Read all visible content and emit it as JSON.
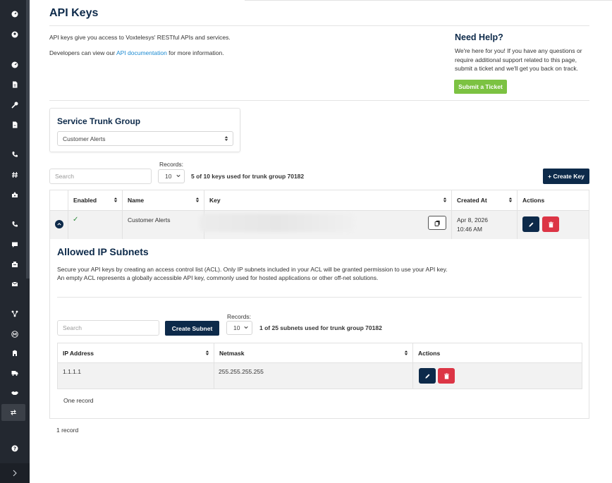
{
  "page": {
    "title": "API Keys",
    "intro_line1": "API keys give you access to Voxtelesys' RESTful APIs and services.",
    "intro_line2_prefix": "Developers can view our ",
    "intro_line2_link": "API documentation",
    "intro_line2_suffix": " for more information."
  },
  "help": {
    "title": "Need Help?",
    "line1": "We're here for you! If you have any questions or",
    "line2": "require additional support related to this page,",
    "line3": "submit a ticket and we'll get you back on track.",
    "button": "Submit a Ticket"
  },
  "trunk_group": {
    "title": "Service Trunk Group",
    "selected": "Customer Alerts"
  },
  "keys_toolbar": {
    "search_placeholder": "Search",
    "records_label": "Records:",
    "records_value": "10",
    "count_text": "5 of 10 keys used for trunk group 70182",
    "create_button": "+ Create Key"
  },
  "keys_table": {
    "headers": [
      "Enabled",
      "Name",
      "Key",
      "Created At",
      "Actions"
    ],
    "rows": [
      {
        "enabled": "✓",
        "name": "Customer Alerts",
        "created_date": "Apr 8, 2026",
        "created_time": "10:46 AM"
      }
    ]
  },
  "subnets": {
    "title": "Allowed IP Subnets",
    "desc_line1": "Secure your API keys by creating an access control list (ACL). Only IP subnets included in your ACL will be granted permission to use your API key.",
    "desc_line2": "An empty ACL represents a globally accessible API key, commonly used for hosted applications or other off-net solutions.",
    "search_placeholder": "Search",
    "create_button": "Create Subnet",
    "records_label": "Records:",
    "records_value": "10",
    "count_text": "1 of 25 subnets used for trunk group 70182",
    "headers": [
      "IP Address",
      "Netmask",
      "Actions"
    ],
    "rows": [
      {
        "ip": "1.1.1.1",
        "netmask": "255.255.255.255"
      }
    ],
    "footer": "One record"
  },
  "keys_footer": "1 record",
  "colors": {
    "sidebar": "#232830",
    "primary": "#0d2a4a",
    "danger": "#dc3545",
    "success": "#7cc242",
    "link": "#1b8ad1"
  },
  "sidebar_icons": [
    "dashboard-icon",
    "user-icon",
    "gauge-icon",
    "document-icon",
    "key-icon",
    "file-icon",
    "phone-icon",
    "hash-icon",
    "inbox-icon",
    "phone-icon",
    "chat-icon",
    "fax-icon",
    "mail-icon",
    "flow-icon",
    "m-icon",
    "building-icon",
    "truck-icon",
    "handshake-icon",
    "transfer-icon",
    "help-icon",
    "chevron-right-icon"
  ]
}
